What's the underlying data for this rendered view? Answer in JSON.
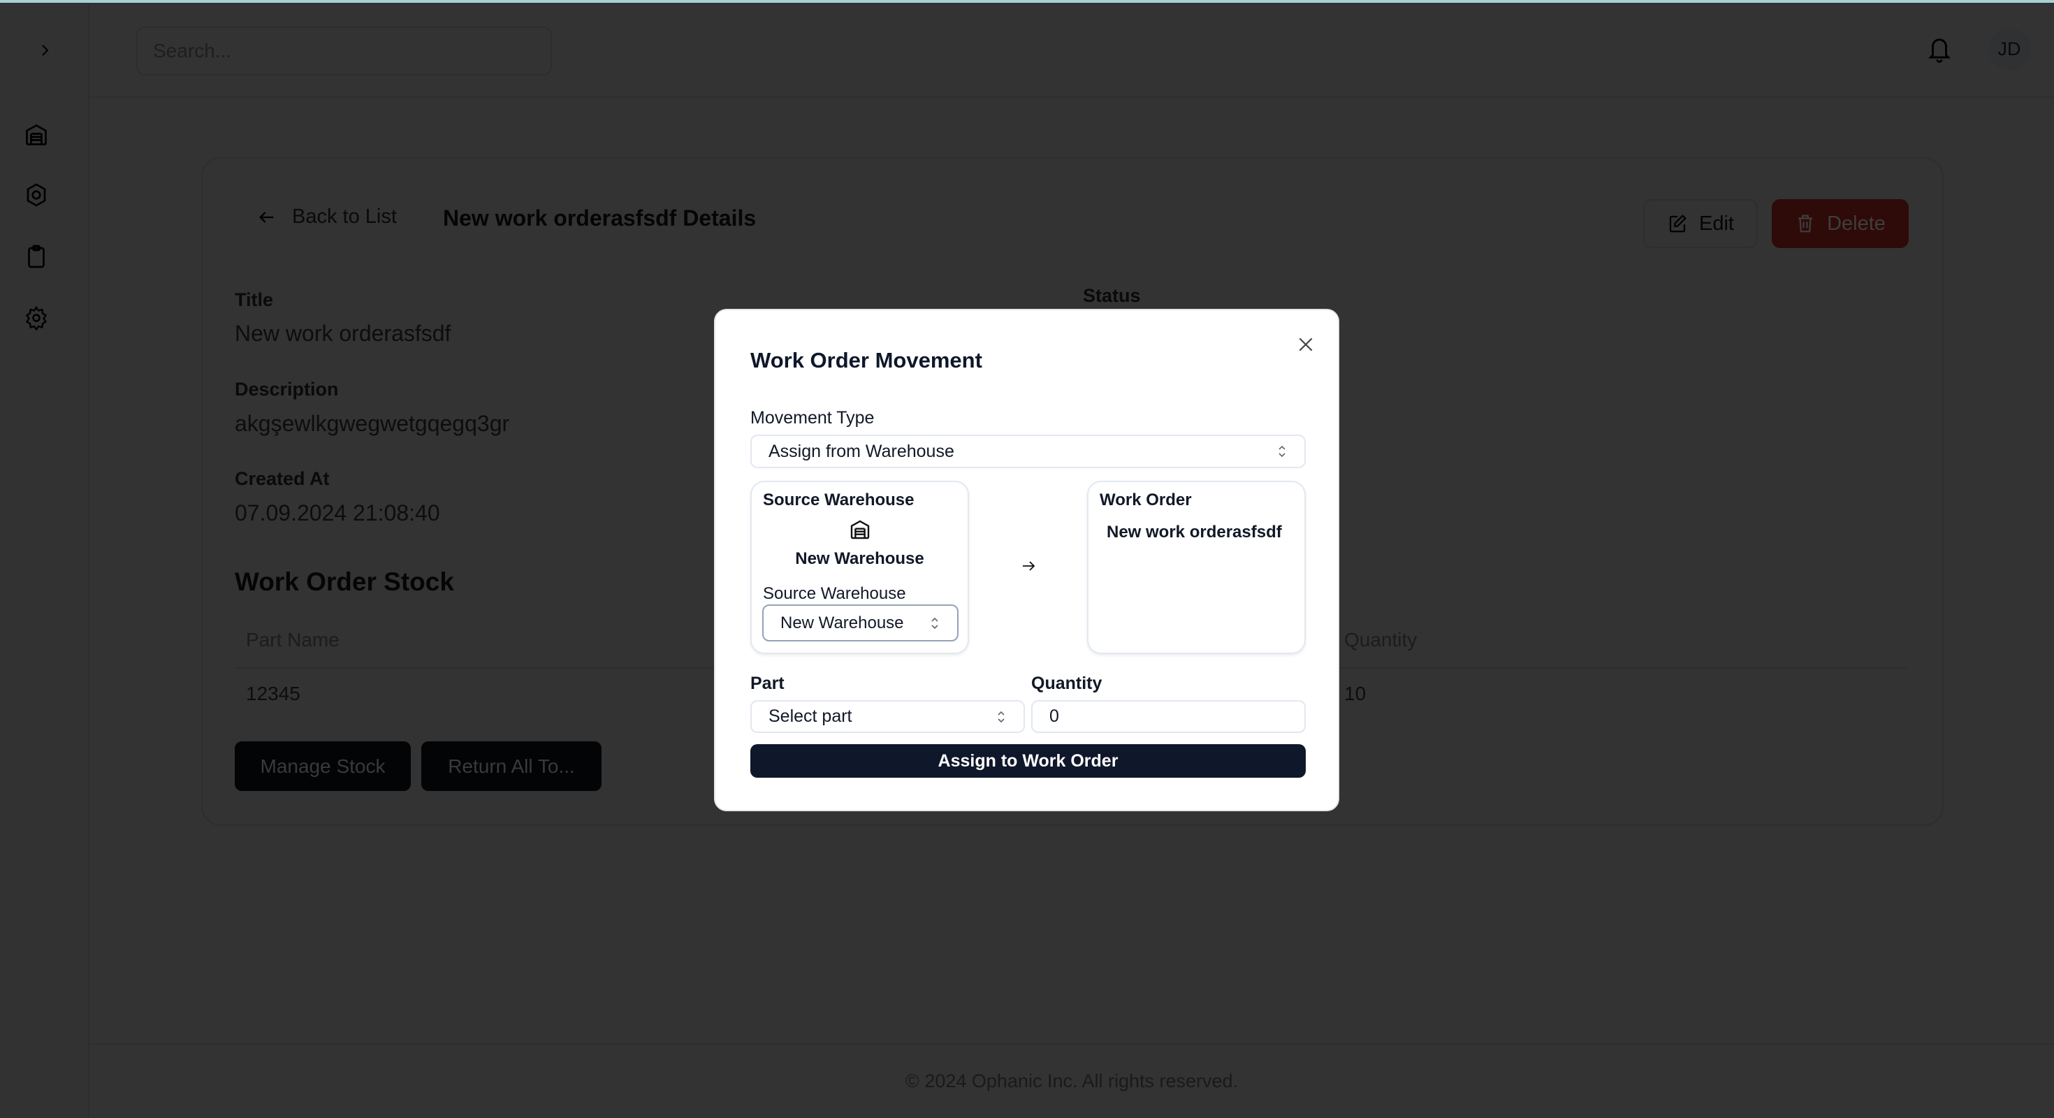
{
  "header": {
    "search_placeholder": "Search...",
    "avatar_initials": "JD"
  },
  "sidebar": {
    "items": [
      {
        "icon": "warehouse-icon"
      },
      {
        "icon": "hexagon-icon"
      },
      {
        "icon": "clipboard-icon"
      },
      {
        "icon": "gear-icon"
      }
    ]
  },
  "detail": {
    "back_label": "Back to List",
    "page_title": "New work orderasfsdf Details",
    "edit_label": "Edit",
    "delete_label": "Delete",
    "fields": [
      {
        "label": "Title",
        "value": "New work orderasfsdf"
      },
      {
        "label": "Description",
        "value": "akgşewlkgwegwetgqegq3gr"
      },
      {
        "label": "Created At",
        "value": "07.09.2024 21:08:40"
      }
    ],
    "status_label": "Status",
    "stock_heading": "Work Order Stock",
    "table": {
      "columns": [
        "Part Name",
        "Quantity"
      ],
      "rows": [
        [
          "12345",
          "10"
        ]
      ]
    },
    "manage_stock_label": "Manage Stock",
    "return_all_label": "Return All To..."
  },
  "footer": {
    "text": "© 2024 Ophanic Inc. All rights reserved."
  },
  "modal": {
    "title": "Work Order Movement",
    "movement_type_label": "Movement Type",
    "movement_type_value": "Assign from Warehouse",
    "source": {
      "heading": "Source Warehouse",
      "name": "New Warehouse",
      "select_label": "Source Warehouse",
      "select_value": "New Warehouse"
    },
    "target": {
      "heading": "Work Order",
      "name": "New work orderasfsdf"
    },
    "part_label": "Part",
    "part_value": "Select part",
    "quantity_label": "Quantity",
    "quantity_value": "0",
    "submit_label": "Assign to Work Order"
  },
  "colors": {
    "primary": "#111827",
    "danger": "#dc2626",
    "overlay": "rgba(0,0,0,0.8)"
  }
}
